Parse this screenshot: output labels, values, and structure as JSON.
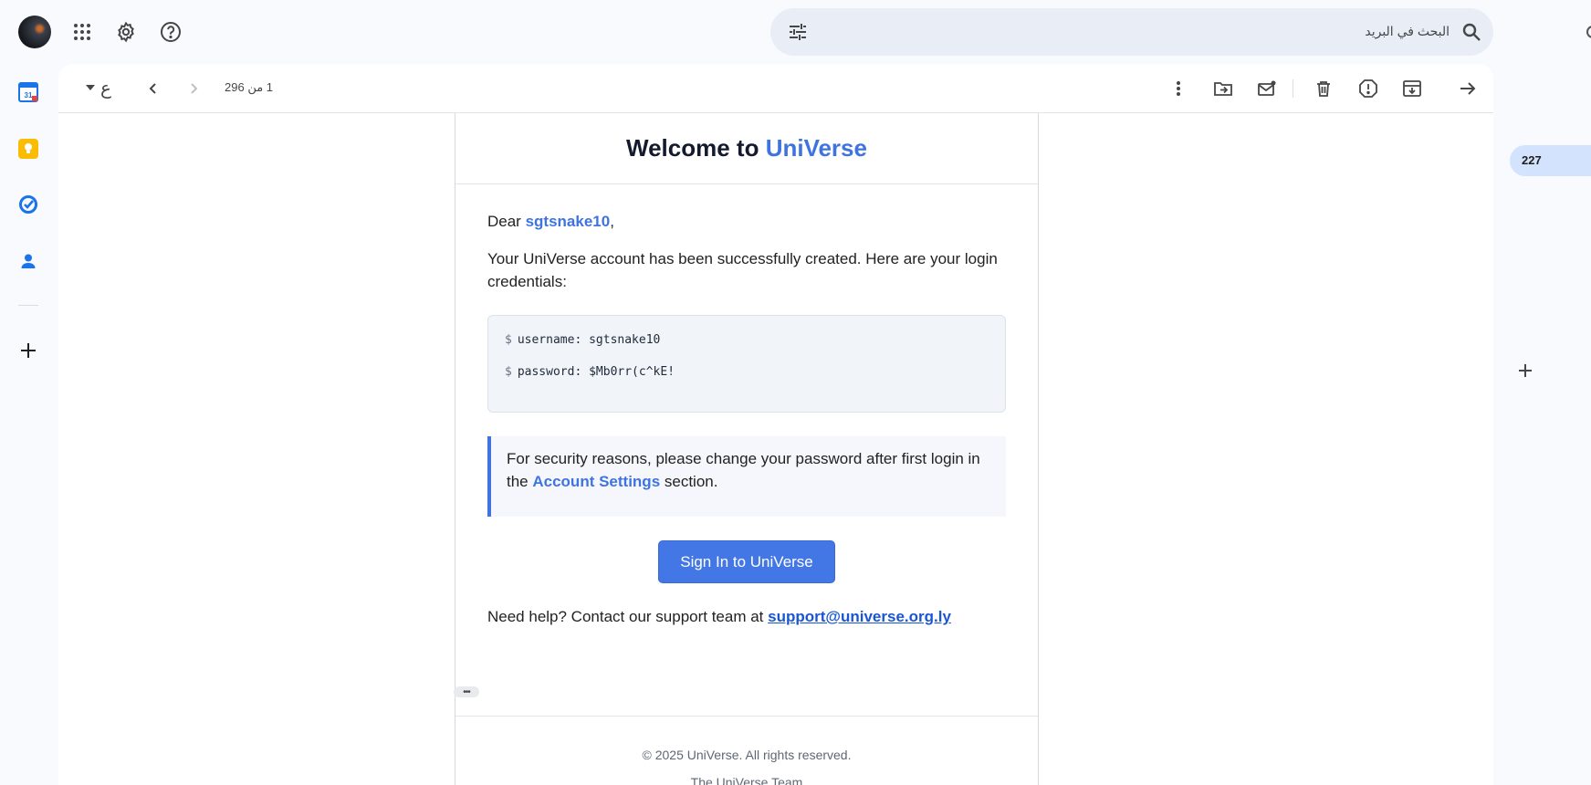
{
  "search": {
    "placeholder": "البحث في البريد"
  },
  "toolbar": {
    "pager_text": "1 من 296",
    "language_glyph": "ع"
  },
  "email": {
    "title_prefix": "Welcome to ",
    "title_brand": "UniVerse",
    "greeting_prefix": "Dear ",
    "greeting_name": "sgtsnake10",
    "greeting_suffix": ",",
    "intro": "Your UniVerse account has been successfully created. Here are your login credentials:",
    "credentials": {
      "prompt": "$",
      "username_line": "username: sgtsnake10",
      "password_line": "password: $Mb0rr(c^kE!"
    },
    "notice_prefix": "For security reasons, please change your password after first login in the ",
    "notice_link": "Account Settings",
    "notice_suffix": " section.",
    "signin_button": "Sign In to UniVerse",
    "help_prefix": "Need help? Contact our support team at ",
    "support_email": "support@universe.org.ly",
    "footer_copyright": "© 2025 UniVerse. All rights reserved.",
    "footer_team": "The UniVerse Team"
  },
  "side": {
    "count_badge": "227"
  },
  "icons": {
    "apps": "apps-grid-icon",
    "settings": "gear-icon",
    "help": "help-icon",
    "calendar": "calendar-icon",
    "keep": "keep-icon",
    "tasks": "tasks-icon",
    "contacts": "contacts-icon",
    "add": "plus-icon",
    "filter": "tune-icon",
    "search": "search-icon",
    "forward": "arrow-forward-icon",
    "archive": "archive-icon",
    "spam": "report-icon",
    "delete": "trash-icon",
    "mark_unread": "mark-unread-icon",
    "move": "move-to-icon",
    "more": "more-vertical-icon",
    "prev": "chevron-left-icon",
    "next": "chevron-right-icon"
  },
  "colors": {
    "brand": "#3f74e0",
    "button": "#4377e6",
    "chip": "#d3e3fd"
  }
}
